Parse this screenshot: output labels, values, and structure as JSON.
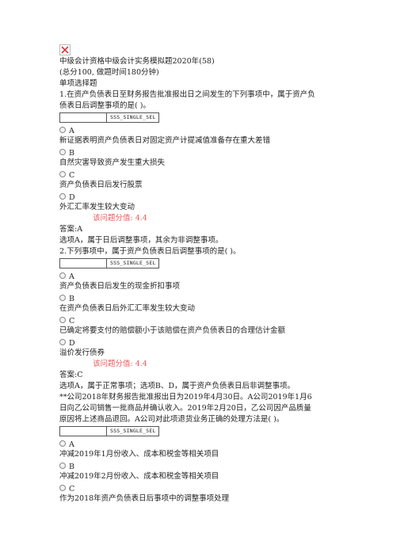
{
  "header": {
    "title": "中级会计资格中级会计实务模拟题2020年(58)",
    "subtitle": "(总分100, 做题时间180分钟)",
    "section": "单项选择题"
  },
  "questions": [
    {
      "stem_lines": [
        "1.在资产负债表日至财务报告批准报出日之间发生的下列事项中，属于资产负",
        "债表日后调整事项的是( )。"
      ],
      "select_tag": "SSS_SINGLE_SEL",
      "options": [
        {
          "letter": "A",
          "text": "新证据表明资产负债表日对固定资产计提减值准备存在重大差错"
        },
        {
          "letter": "B",
          "text": "自然灾害导致资产发生重大损失"
        },
        {
          "letter": "C",
          "text": "资产负债表日后发行股票"
        },
        {
          "letter": "D",
          "text": "外汇汇率发生较大变动"
        }
      ],
      "score": "该问题分值: 4.4",
      "answer": "答案:A",
      "explanation_lines": [
        "选项A，属于日后调整事项，其余为非调整事项。"
      ]
    },
    {
      "stem_lines": [
        "2.下列事项中，属于资产负债表日后调整事项的是( )。"
      ],
      "select_tag": "SSS_SINGLE_SEL",
      "options": [
        {
          "letter": "A",
          "text": "资产负债表日后发生的现金折扣事项"
        },
        {
          "letter": "B",
          "text": "在资产负债表日后外汇汇率发生较大变动"
        },
        {
          "letter": "C",
          "text": "已确定将要支付的赔偿额小于该赔偿在资产负债表日的合理估计金额"
        },
        {
          "letter": "D",
          "text": "溢价发行债券"
        }
      ],
      "score": "该问题分值: 4.4",
      "answer": "答案:C",
      "explanation_lines": [
        "选项A，属于正常事项；选项B、D，属于资产负债表日后非调整事项。"
      ]
    },
    {
      "stem_lines": [
        "**公司2018年财务报告批准报出日为2019年4月30日。A公司2019年1月6",
        "日向乙公司销售一批商品并确认收入。2019年2月20日，乙公司因产品质量",
        "原因将上述商品退回。A公司对此项退货业务正确的处理方法是( )。"
      ],
      "select_tag": "SSS_SINGLE_SEL",
      "options": [
        {
          "letter": "A",
          "text": "冲减2019年1月份收入、成本和税金等相关项目"
        },
        {
          "letter": "B",
          "text": "冲减2019年2月份收入、成本和税金等相关项目"
        },
        {
          "letter": "C",
          "text": "作为2018年资产负债表日后事项中的调整事项处理"
        }
      ]
    }
  ]
}
